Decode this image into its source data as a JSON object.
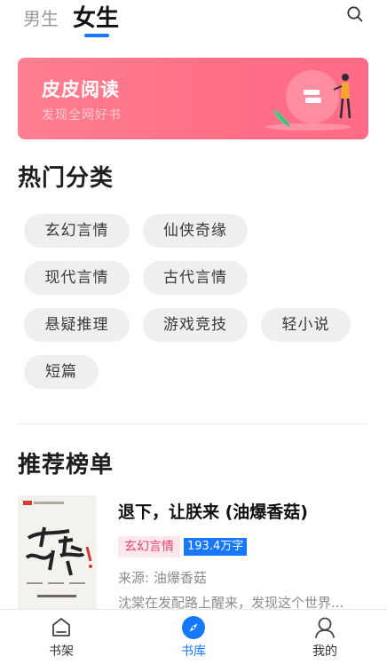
{
  "header": {
    "tabs": [
      {
        "label": "男生",
        "active": false
      },
      {
        "label": "女生",
        "active": true
      }
    ],
    "search_icon": "search-icon",
    "accent_color": "#1677ff"
  },
  "banner": {
    "title": "皮皮阅读",
    "subtitle": "发现全网好书",
    "bg_color": "#ff7088"
  },
  "hot_categories": {
    "title": "热门分类",
    "items": [
      "玄幻言情",
      "仙侠奇缘",
      "现代言情",
      "古代言情",
      "悬疑推理",
      "游戏竞技",
      "轻小说",
      "短篇"
    ]
  },
  "rankings": {
    "title": "推荐榜单",
    "books": [
      {
        "title": "退下，让朕来 (油爆香菇)",
        "genre": "玄幻言情",
        "words": "193.4万字",
        "source": "来源: 油爆香菇",
        "description": "沈棠在发配路上醒来，发现这个世界...",
        "cover_text": "退下让朕来"
      }
    ]
  },
  "bottom_nav": {
    "items": [
      {
        "label": "书架",
        "icon": "bookshelf-icon",
        "active": false
      },
      {
        "label": "书库",
        "icon": "compass-icon",
        "active": true
      },
      {
        "label": "我的",
        "icon": "user-icon",
        "active": false
      }
    ]
  }
}
